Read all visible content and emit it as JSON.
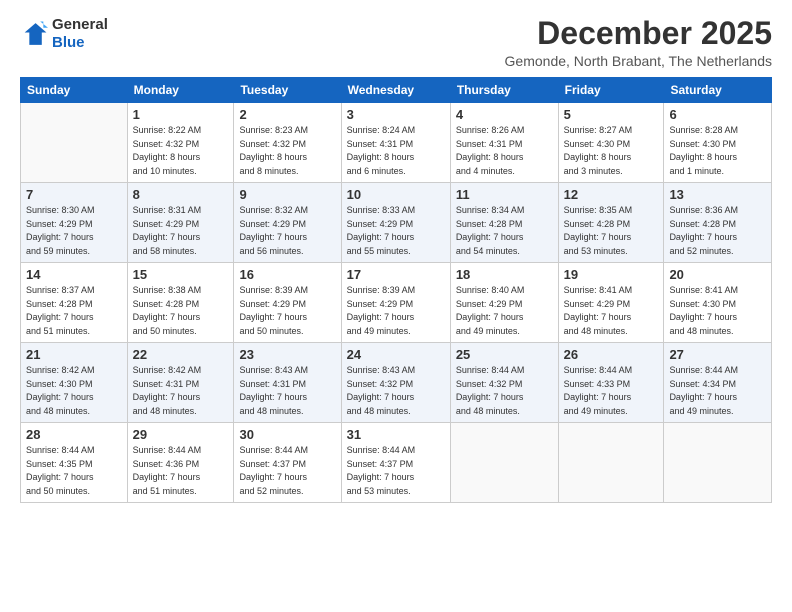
{
  "logo": {
    "line1": "General",
    "line2": "Blue"
  },
  "title": "December 2025",
  "location": "Gemonde, North Brabant, The Netherlands",
  "weekdays": [
    "Sunday",
    "Monday",
    "Tuesday",
    "Wednesday",
    "Thursday",
    "Friday",
    "Saturday"
  ],
  "weeks": [
    [
      {
        "day": "",
        "info": ""
      },
      {
        "day": "1",
        "info": "Sunrise: 8:22 AM\nSunset: 4:32 PM\nDaylight: 8 hours\nand 10 minutes."
      },
      {
        "day": "2",
        "info": "Sunrise: 8:23 AM\nSunset: 4:32 PM\nDaylight: 8 hours\nand 8 minutes."
      },
      {
        "day": "3",
        "info": "Sunrise: 8:24 AM\nSunset: 4:31 PM\nDaylight: 8 hours\nand 6 minutes."
      },
      {
        "day": "4",
        "info": "Sunrise: 8:26 AM\nSunset: 4:31 PM\nDaylight: 8 hours\nand 4 minutes."
      },
      {
        "day": "5",
        "info": "Sunrise: 8:27 AM\nSunset: 4:30 PM\nDaylight: 8 hours\nand 3 minutes."
      },
      {
        "day": "6",
        "info": "Sunrise: 8:28 AM\nSunset: 4:30 PM\nDaylight: 8 hours\nand 1 minute."
      }
    ],
    [
      {
        "day": "7",
        "info": "Sunrise: 8:30 AM\nSunset: 4:29 PM\nDaylight: 7 hours\nand 59 minutes."
      },
      {
        "day": "8",
        "info": "Sunrise: 8:31 AM\nSunset: 4:29 PM\nDaylight: 7 hours\nand 58 minutes."
      },
      {
        "day": "9",
        "info": "Sunrise: 8:32 AM\nSunset: 4:29 PM\nDaylight: 7 hours\nand 56 minutes."
      },
      {
        "day": "10",
        "info": "Sunrise: 8:33 AM\nSunset: 4:29 PM\nDaylight: 7 hours\nand 55 minutes."
      },
      {
        "day": "11",
        "info": "Sunrise: 8:34 AM\nSunset: 4:28 PM\nDaylight: 7 hours\nand 54 minutes."
      },
      {
        "day": "12",
        "info": "Sunrise: 8:35 AM\nSunset: 4:28 PM\nDaylight: 7 hours\nand 53 minutes."
      },
      {
        "day": "13",
        "info": "Sunrise: 8:36 AM\nSunset: 4:28 PM\nDaylight: 7 hours\nand 52 minutes."
      }
    ],
    [
      {
        "day": "14",
        "info": "Sunrise: 8:37 AM\nSunset: 4:28 PM\nDaylight: 7 hours\nand 51 minutes."
      },
      {
        "day": "15",
        "info": "Sunrise: 8:38 AM\nSunset: 4:28 PM\nDaylight: 7 hours\nand 50 minutes."
      },
      {
        "day": "16",
        "info": "Sunrise: 8:39 AM\nSunset: 4:29 PM\nDaylight: 7 hours\nand 50 minutes."
      },
      {
        "day": "17",
        "info": "Sunrise: 8:39 AM\nSunset: 4:29 PM\nDaylight: 7 hours\nand 49 minutes."
      },
      {
        "day": "18",
        "info": "Sunrise: 8:40 AM\nSunset: 4:29 PM\nDaylight: 7 hours\nand 49 minutes."
      },
      {
        "day": "19",
        "info": "Sunrise: 8:41 AM\nSunset: 4:29 PM\nDaylight: 7 hours\nand 48 minutes."
      },
      {
        "day": "20",
        "info": "Sunrise: 8:41 AM\nSunset: 4:30 PM\nDaylight: 7 hours\nand 48 minutes."
      }
    ],
    [
      {
        "day": "21",
        "info": "Sunrise: 8:42 AM\nSunset: 4:30 PM\nDaylight: 7 hours\nand 48 minutes."
      },
      {
        "day": "22",
        "info": "Sunrise: 8:42 AM\nSunset: 4:31 PM\nDaylight: 7 hours\nand 48 minutes."
      },
      {
        "day": "23",
        "info": "Sunrise: 8:43 AM\nSunset: 4:31 PM\nDaylight: 7 hours\nand 48 minutes."
      },
      {
        "day": "24",
        "info": "Sunrise: 8:43 AM\nSunset: 4:32 PM\nDaylight: 7 hours\nand 48 minutes."
      },
      {
        "day": "25",
        "info": "Sunrise: 8:44 AM\nSunset: 4:32 PM\nDaylight: 7 hours\nand 48 minutes."
      },
      {
        "day": "26",
        "info": "Sunrise: 8:44 AM\nSunset: 4:33 PM\nDaylight: 7 hours\nand 49 minutes."
      },
      {
        "day": "27",
        "info": "Sunrise: 8:44 AM\nSunset: 4:34 PM\nDaylight: 7 hours\nand 49 minutes."
      }
    ],
    [
      {
        "day": "28",
        "info": "Sunrise: 8:44 AM\nSunset: 4:35 PM\nDaylight: 7 hours\nand 50 minutes."
      },
      {
        "day": "29",
        "info": "Sunrise: 8:44 AM\nSunset: 4:36 PM\nDaylight: 7 hours\nand 51 minutes."
      },
      {
        "day": "30",
        "info": "Sunrise: 8:44 AM\nSunset: 4:37 PM\nDaylight: 7 hours\nand 52 minutes."
      },
      {
        "day": "31",
        "info": "Sunrise: 8:44 AM\nSunset: 4:37 PM\nDaylight: 7 hours\nand 53 minutes."
      },
      {
        "day": "",
        "info": ""
      },
      {
        "day": "",
        "info": ""
      },
      {
        "day": "",
        "info": ""
      }
    ]
  ]
}
